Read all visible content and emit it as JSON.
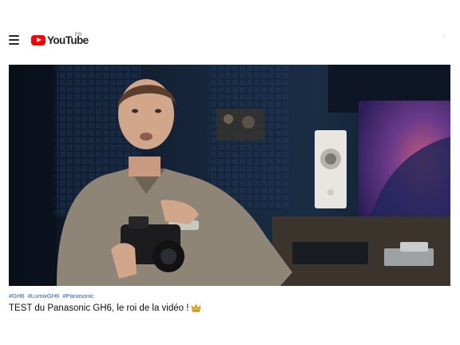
{
  "app": {
    "name": "YouTube",
    "country_code": "FR"
  },
  "header": {
    "menu_icon": "hamburger-menu-icon",
    "logo_icon": "youtube-play-icon"
  },
  "video": {
    "thumbnail_description": "Man in grey sweater holding a Panasonic Lumix GH6 camera in a studio with studio monitor speaker and desktop screen",
    "hashtags": [
      "#GH6",
      "#LumixGH6",
      "#Panasonic"
    ],
    "title": "TEST du Panasonic GH6, le roi de la vidéo !",
    "title_emoji_icon": "crown-emoji-icon"
  },
  "colors": {
    "brand_red": "#ff0000",
    "hashtag_blue": "#1b56c7",
    "title_text": "#0f0f0f"
  }
}
